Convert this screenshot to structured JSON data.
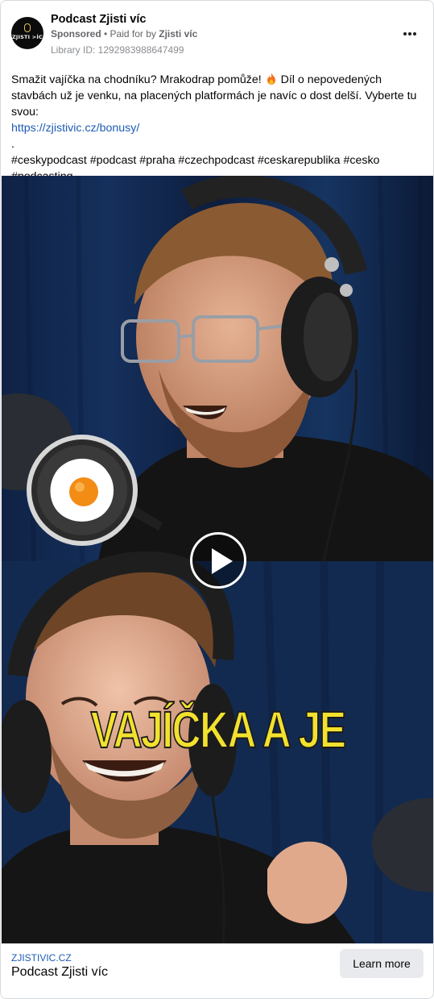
{
  "header": {
    "page_name": "Podcast Zjisti víc",
    "sponsored": "Sponsored",
    "paid_for_by_prefix": " • Paid for by ",
    "paid_for_by": "Zjisti víc",
    "library_id": "Library ID: 1292983988647499",
    "avatar_text": "ZJISTI >ÍC"
  },
  "post": {
    "text_before_flame": "Smažit vajíčka na chodníku? Mrakodrap pomůže! ",
    "text_after_flame": " Díl o nepovedených stavbách už je venku, na placených platformách je navíc o dost delší. Vyberte tu svou:",
    "link": "https://zjistivic.cz/bonusy/",
    "dot": ".",
    "hashtags_line1": "#ceskypodcast #podcast #praha #czechpodcast #ceskarepublika #cesko",
    "hashtags_line2": "#podcasting"
  },
  "video": {
    "caption": "VAJÍČKA A JE"
  },
  "footer": {
    "domain": "ZJISTIVIC.CZ",
    "title": "Podcast Zjisti víc",
    "cta_label": "Learn more"
  },
  "icons": {
    "more": "more-horizontal-icon",
    "play": "play-icon",
    "flame": "fire-emoji",
    "egg": "fried-egg-pan-icon"
  },
  "colors": {
    "link": "#1d5bb5",
    "caption_yellow": "#f2e12e",
    "cta_bg": "#e8eaed"
  }
}
